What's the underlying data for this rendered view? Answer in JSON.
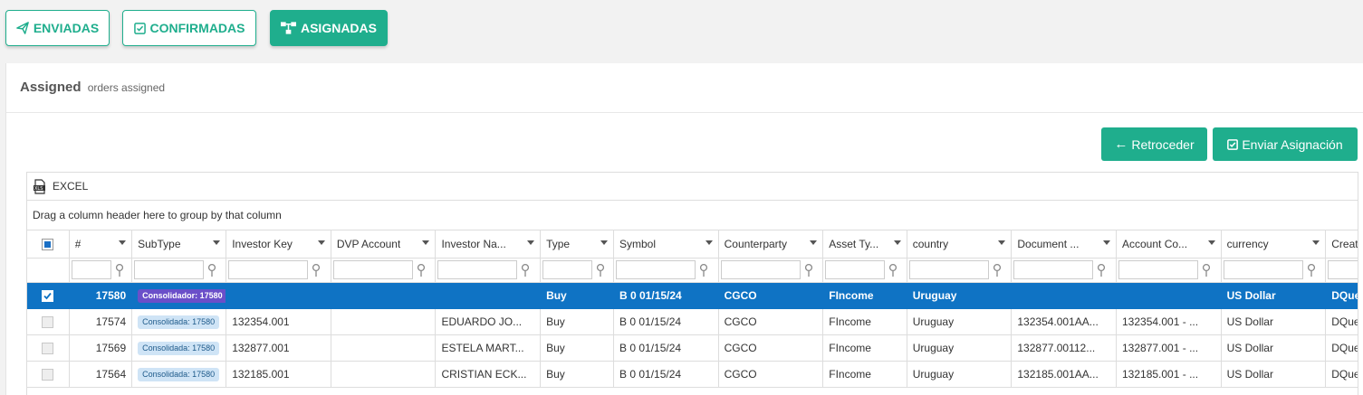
{
  "tabs": [
    {
      "label": "ENVIADAS",
      "icon": "send-icon"
    },
    {
      "label": "CONFIRMADAS",
      "icon": "check-square-icon"
    },
    {
      "label": "ASIGNADAS",
      "icon": "sitemap-icon"
    }
  ],
  "heading": {
    "title": "Assigned",
    "subtitle": "orders assigned"
  },
  "actions": {
    "back_label": "Retroceder",
    "send_label": "Enviar Asignación"
  },
  "toolbar": {
    "excel_label": "EXCEL"
  },
  "group_hint": "Drag a column header here to group by that column",
  "columns": [
    "#",
    "SubType",
    "Investor Key",
    "DVP Account",
    "Investor Na...",
    "Type",
    "Symbol",
    "Counterparty",
    "Asset Ty...",
    "country",
    "Document ...",
    "Account Co...",
    "currency",
    "Created By"
  ],
  "rows": [
    {
      "selected": true,
      "id": "17580",
      "subtype": "Consolidador: 17580",
      "investor_key": "",
      "dvp": "",
      "investor_name": "",
      "type": "Buy",
      "symbol": "B 0 01/15/24",
      "counterparty": "CGCO",
      "asset_type": "FIncome",
      "country": "Uruguay",
      "document": "",
      "account": "",
      "currency": "US Dollar",
      "created_by": "DQuevedo"
    },
    {
      "selected": false,
      "id": "17574",
      "subtype": "Consolidada: 17580",
      "investor_key": "132354.001",
      "dvp": "",
      "investor_name": "EDUARDO JO...",
      "type": "Buy",
      "symbol": "B 0 01/15/24",
      "counterparty": "CGCO",
      "asset_type": "FIncome",
      "country": "Uruguay",
      "document": "132354.001AA...",
      "account": "132354.001 - ...",
      "currency": "US Dollar",
      "created_by": "DQuevedo"
    },
    {
      "selected": false,
      "id": "17569",
      "subtype": "Consolidada: 17580",
      "investor_key": "132877.001",
      "dvp": "",
      "investor_name": "ESTELA MART...",
      "type": "Buy",
      "symbol": "B 0 01/15/24",
      "counterparty": "CGCO",
      "asset_type": "FIncome",
      "country": "Uruguay",
      "document": "132877.00112...",
      "account": "132877.001 - ...",
      "currency": "US Dollar",
      "created_by": "DQuevedo"
    },
    {
      "selected": false,
      "id": "17564",
      "subtype": "Consolidada: 17580",
      "investor_key": "132185.001",
      "dvp": "",
      "investor_name": "CRISTIAN ECK...",
      "type": "Buy",
      "symbol": "B 0 01/15/24",
      "counterparty": "CGCO",
      "asset_type": "FIncome",
      "country": "Uruguay",
      "document": "132185.001AA...",
      "account": "132185.001 - ...",
      "currency": "US Dollar",
      "created_by": "DQuevedo"
    }
  ],
  "colors": {
    "accent": "#1fae8d",
    "selected_row": "#0f73c4",
    "badge_primary": "#6a4fc9",
    "badge_secondary": "#cfe4f6"
  }
}
